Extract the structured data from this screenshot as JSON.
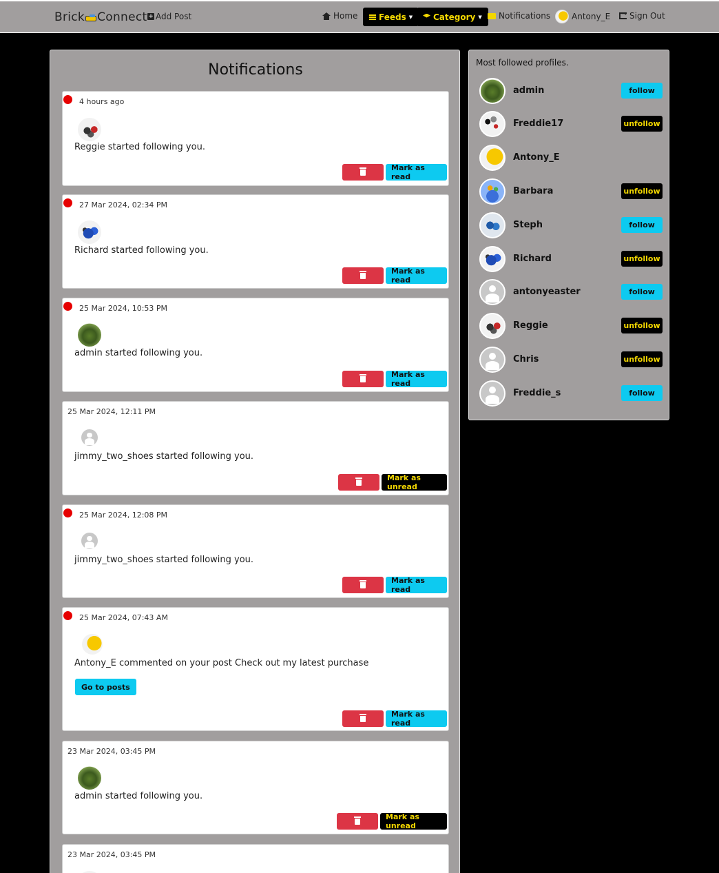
{
  "navbar": {
    "brand_left": "Brick",
    "brand_right": "Connect",
    "add_post": "Add Post",
    "home": "Home",
    "feeds": "Feeds",
    "category": "Category",
    "notifications": "Notifications",
    "username": "Antony_E",
    "sign_out": "Sign Out"
  },
  "main": {
    "title": "Notifications",
    "delete_icon": "trash-icon",
    "mark_read_label": "Mark as read",
    "mark_unread_label": "Mark as unread",
    "go_to_posts_label": "Go to posts",
    "notifications": [
      {
        "time": "4 hours ago",
        "message": "Reggie started following you.",
        "unread": true
      },
      {
        "time": "27 Mar 2024, 02:34 PM",
        "message": "Richard started following you.",
        "unread": true
      },
      {
        "time": "25 Mar 2024, 10:53 PM",
        "message": "admin started following you.",
        "unread": true
      },
      {
        "time": "25 Mar 2024, 12:11 PM",
        "message": "jimmy_two_shoes started following you.",
        "unread": false
      },
      {
        "time": "25 Mar 2024, 12:08 PM",
        "message": "jimmy_two_shoes started following you.",
        "unread": true
      },
      {
        "time": "25 Mar 2024, 07:43 AM",
        "message": "Antony_E commented on your post Check out my latest purchase",
        "unread": true
      },
      {
        "time": "23 Mar 2024, 03:45 PM",
        "message": "admin started following you.",
        "unread": false
      },
      {
        "time": "23 Mar 2024, 03:45 PM",
        "message": "",
        "unread": false
      }
    ]
  },
  "sidebar": {
    "title": "Most followed profiles.",
    "follow_label": "follow",
    "unfollow_label": "unfollow",
    "profiles": [
      {
        "name": "admin",
        "action": "follow"
      },
      {
        "name": "Freddie17",
        "action": "unfollow"
      },
      {
        "name": "Antony_E",
        "action": ""
      },
      {
        "name": "Barbara",
        "action": "unfollow"
      },
      {
        "name": "Steph",
        "action": "follow"
      },
      {
        "name": "Richard",
        "action": "unfollow"
      },
      {
        "name": "antonyeaster",
        "action": "follow"
      },
      {
        "name": "Reggie",
        "action": "unfollow"
      },
      {
        "name": "Chris",
        "action": "unfollow"
      },
      {
        "name": "Freddie_s",
        "action": "follow"
      }
    ]
  },
  "colors": {
    "navbar_bg": "#a19e9e",
    "page_bg": "#000000",
    "accent_yellow": "#f3d700",
    "follow_cyan": "#0dcaf0",
    "delete_red": "#dc3545",
    "unread_dot": "#e60000"
  }
}
